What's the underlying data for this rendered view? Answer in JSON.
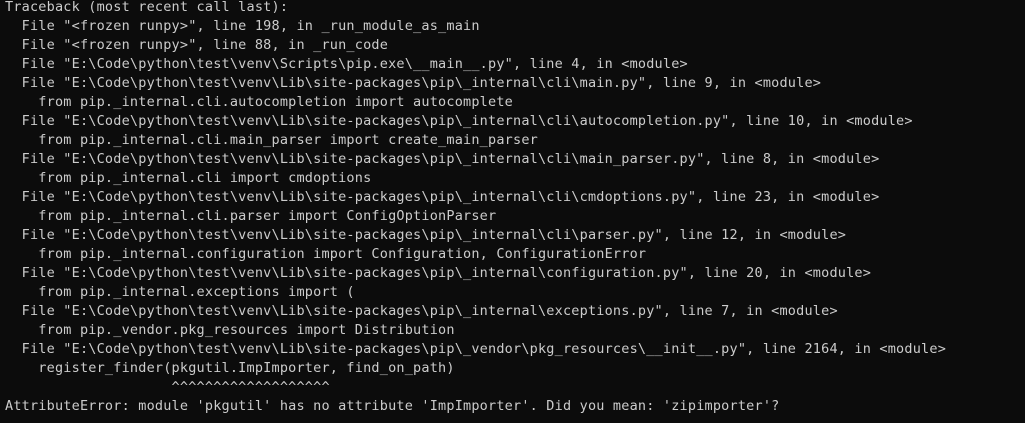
{
  "terminal": {
    "lines": [
      "Traceback (most recent call last):",
      "  File \"<frozen runpy>\", line 198, in _run_module_as_main",
      "  File \"<frozen runpy>\", line 88, in _run_code",
      "  File \"E:\\Code\\python\\test\\venv\\Scripts\\pip.exe\\__main__.py\", line 4, in <module>",
      "  File \"E:\\Code\\python\\test\\venv\\Lib\\site-packages\\pip\\_internal\\cli\\main.py\", line 9, in <module>",
      "    from pip._internal.cli.autocompletion import autocomplete",
      "  File \"E:\\Code\\python\\test\\venv\\Lib\\site-packages\\pip\\_internal\\cli\\autocompletion.py\", line 10, in <module>",
      "    from pip._internal.cli.main_parser import create_main_parser",
      "  File \"E:\\Code\\python\\test\\venv\\Lib\\site-packages\\pip\\_internal\\cli\\main_parser.py\", line 8, in <module>",
      "    from pip._internal.cli import cmdoptions",
      "  File \"E:\\Code\\python\\test\\venv\\Lib\\site-packages\\pip\\_internal\\cli\\cmdoptions.py\", line 23, in <module>",
      "    from pip._internal.cli.parser import ConfigOptionParser",
      "  File \"E:\\Code\\python\\test\\venv\\Lib\\site-packages\\pip\\_internal\\cli\\parser.py\", line 12, in <module>",
      "    from pip._internal.configuration import Configuration, ConfigurationError",
      "  File \"E:\\Code\\python\\test\\venv\\Lib\\site-packages\\pip\\_internal\\configuration.py\", line 20, in <module>",
      "    from pip._internal.exceptions import (",
      "  File \"E:\\Code\\python\\test\\venv\\Lib\\site-packages\\pip\\_internal\\exceptions.py\", line 7, in <module>",
      "    from pip._vendor.pkg_resources import Distribution",
      "  File \"E:\\Code\\python\\test\\venv\\Lib\\site-packages\\pip\\_vendor\\pkg_resources\\__init__.py\", line 2164, in <module>",
      "    register_finder(pkgutil.ImpImporter, find_on_path)",
      "                    ^^^^^^^^^^^^^^^^^^^",
      "AttributeError: module 'pkgutil' has no attribute 'ImpImporter'. Did you mean: 'zipimporter'?"
    ]
  },
  "colors": {
    "background": "#0c0c0c",
    "text": "#cccccc"
  }
}
